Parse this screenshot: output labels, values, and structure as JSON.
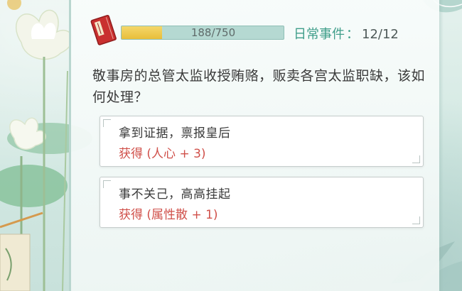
{
  "header": {
    "progress_text": "188/750",
    "progress_fraction": 0.25,
    "event_label": "日常事件",
    "event_separator": "：",
    "event_count": "12/12"
  },
  "question": "敬事房的总管太监收授贿赂，贩卖各宫太监职缺，该如何处理？",
  "options": [
    {
      "title": "拿到证据，禀报皇后",
      "reward": "获得 (人心 + 3)"
    },
    {
      "title": "事不关己，高高挂起",
      "reward": "获得 (属性散 + 1)"
    }
  ],
  "colors": {
    "accent": "#3f9e8a",
    "reward": "#d0504a",
    "progress_fill": "#e8be3a",
    "progress_track": "#b5d9d2"
  },
  "icons": [
    "book-icon",
    "lotus-decoration",
    "fish-decoration"
  ]
}
